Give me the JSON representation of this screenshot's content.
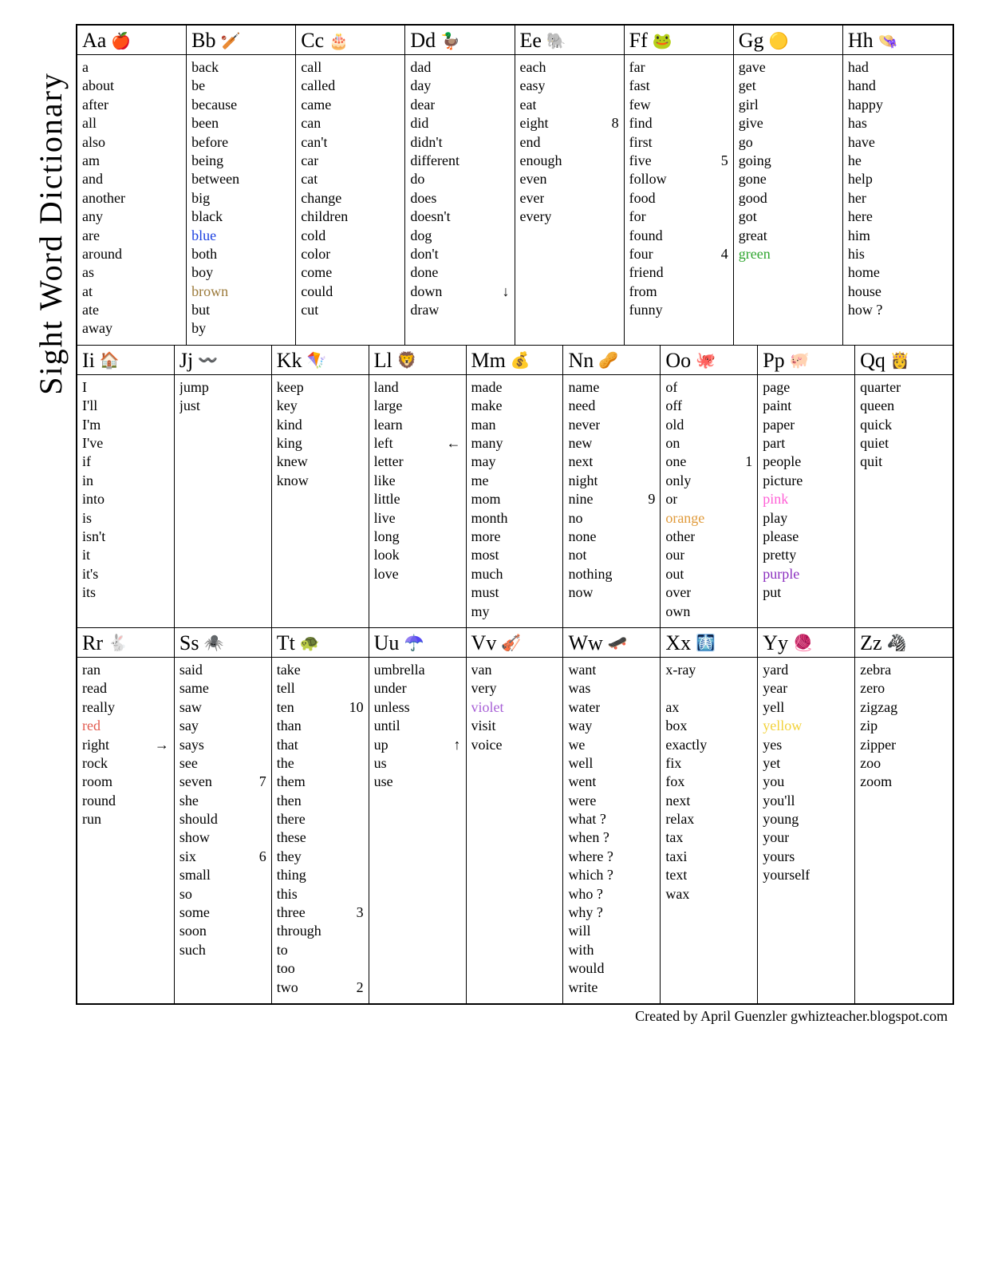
{
  "title": "Sight Word Dictionary",
  "footer": "Created by April Guenzler   gwhizteacher.blogspot.com",
  "rows": [
    {
      "cells": [
        {
          "letter": "Aa",
          "icon": "🍎",
          "words": [
            {
              "t": "a"
            },
            {
              "t": "about"
            },
            {
              "t": "after"
            },
            {
              "t": "all"
            },
            {
              "t": "also"
            },
            {
              "t": "am"
            },
            {
              "t": "and"
            },
            {
              "t": "another"
            },
            {
              "t": "any"
            },
            {
              "t": "are"
            },
            {
              "t": "around"
            },
            {
              "t": "as"
            },
            {
              "t": "at"
            },
            {
              "t": "ate"
            },
            {
              "t": "away"
            }
          ]
        },
        {
          "letter": "Bb",
          "icon": "🏏",
          "words": [
            {
              "t": "back"
            },
            {
              "t": "be"
            },
            {
              "t": "because"
            },
            {
              "t": "been"
            },
            {
              "t": "before"
            },
            {
              "t": "being"
            },
            {
              "t": "between"
            },
            {
              "t": "big"
            },
            {
              "t": "black"
            },
            {
              "t": "blue",
              "c": "#1a3fe0"
            },
            {
              "t": "both"
            },
            {
              "t": "boy"
            },
            {
              "t": "brown",
              "c": "#9b7a3a"
            },
            {
              "t": "but"
            },
            {
              "t": "by"
            }
          ]
        },
        {
          "letter": "Cc",
          "icon": "🎂",
          "words": [
            {
              "t": "call"
            },
            {
              "t": "called"
            },
            {
              "t": "came"
            },
            {
              "t": "can"
            },
            {
              "t": "can't"
            },
            {
              "t": "car"
            },
            {
              "t": "cat"
            },
            {
              "t": "change"
            },
            {
              "t": "children"
            },
            {
              "t": "cold"
            },
            {
              "t": "color"
            },
            {
              "t": "come"
            },
            {
              "t": "could"
            },
            {
              "t": "cut"
            }
          ]
        },
        {
          "letter": "Dd",
          "icon": "🦆",
          "words": [
            {
              "t": "dad"
            },
            {
              "t": "day"
            },
            {
              "t": "dear"
            },
            {
              "t": "did"
            },
            {
              "t": "didn't"
            },
            {
              "t": "different"
            },
            {
              "t": "do"
            },
            {
              "t": "does"
            },
            {
              "t": "doesn't"
            },
            {
              "t": "dog"
            },
            {
              "t": "don't"
            },
            {
              "t": "done"
            },
            {
              "t": "down",
              "e": "↓"
            },
            {
              "t": "draw"
            }
          ]
        },
        {
          "letter": "Ee",
          "icon": "🐘",
          "words": [
            {
              "t": "each"
            },
            {
              "t": "easy"
            },
            {
              "t": "eat"
            },
            {
              "t": "eight",
              "e": "8"
            },
            {
              "t": "end"
            },
            {
              "t": "enough"
            },
            {
              "t": "even"
            },
            {
              "t": "ever"
            },
            {
              "t": "every"
            }
          ]
        },
        {
          "letter": "Ff",
          "icon": "🐸",
          "words": [
            {
              "t": "far"
            },
            {
              "t": "fast"
            },
            {
              "t": "few"
            },
            {
              "t": "find"
            },
            {
              "t": "first"
            },
            {
              "t": "five",
              "e": "5"
            },
            {
              "t": "follow"
            },
            {
              "t": "food"
            },
            {
              "t": "for"
            },
            {
              "t": "found"
            },
            {
              "t": "four",
              "e": "4"
            },
            {
              "t": "friend"
            },
            {
              "t": "from"
            },
            {
              "t": "funny"
            }
          ]
        },
        {
          "letter": "Gg",
          "icon": "🟡",
          "words": [
            {
              "t": "gave"
            },
            {
              "t": "get"
            },
            {
              "t": "girl"
            },
            {
              "t": "give"
            },
            {
              "t": "go"
            },
            {
              "t": "going"
            },
            {
              "t": "gone"
            },
            {
              "t": "good"
            },
            {
              "t": "got"
            },
            {
              "t": "great"
            },
            {
              "t": "green",
              "c": "#2fa52f"
            }
          ]
        },
        {
          "letter": "Hh",
          "icon": "👒",
          "words": [
            {
              "t": "had"
            },
            {
              "t": "hand"
            },
            {
              "t": "happy"
            },
            {
              "t": "has"
            },
            {
              "t": "have"
            },
            {
              "t": "he"
            },
            {
              "t": "help"
            },
            {
              "t": "her"
            },
            {
              "t": "here"
            },
            {
              "t": "him"
            },
            {
              "t": "his"
            },
            {
              "t": "home"
            },
            {
              "t": "house"
            },
            {
              "t": "how ?"
            }
          ]
        }
      ]
    },
    {
      "cells": [
        {
          "letter": "Ii",
          "icon": "🏠",
          "words": [
            {
              "t": "I"
            },
            {
              "t": "I'll"
            },
            {
              "t": "I'm"
            },
            {
              "t": "I've"
            },
            {
              "t": "if"
            },
            {
              "t": "in"
            },
            {
              "t": "into"
            },
            {
              "t": "is"
            },
            {
              "t": "isn't"
            },
            {
              "t": "it"
            },
            {
              "t": "it's"
            },
            {
              "t": "its"
            }
          ]
        },
        {
          "letter": "Jj",
          "icon": "〰️",
          "words": [
            {
              "t": "jump"
            },
            {
              "t": "just"
            }
          ]
        },
        {
          "letter": "Kk",
          "icon": "🪁",
          "words": [
            {
              "t": "keep"
            },
            {
              "t": "key"
            },
            {
              "t": "kind"
            },
            {
              "t": "king"
            },
            {
              "t": "knew"
            },
            {
              "t": "know"
            }
          ]
        },
        {
          "letter": "Ll",
          "icon": "🦁",
          "words": [
            {
              "t": "land"
            },
            {
              "t": "large"
            },
            {
              "t": "learn"
            },
            {
              "t": "left",
              "e": "←"
            },
            {
              "t": "letter"
            },
            {
              "t": "like"
            },
            {
              "t": "little"
            },
            {
              "t": "live"
            },
            {
              "t": "long"
            },
            {
              "t": "look"
            },
            {
              "t": "love"
            }
          ]
        },
        {
          "letter": "Mm",
          "icon": "💰",
          "words": [
            {
              "t": "made"
            },
            {
              "t": "make"
            },
            {
              "t": "man"
            },
            {
              "t": "many"
            },
            {
              "t": "may"
            },
            {
              "t": "me"
            },
            {
              "t": "mom"
            },
            {
              "t": "month"
            },
            {
              "t": "more"
            },
            {
              "t": "most"
            },
            {
              "t": "much"
            },
            {
              "t": "must"
            },
            {
              "t": "my"
            }
          ]
        },
        {
          "letter": "Nn",
          "icon": "🥜",
          "words": [
            {
              "t": "name"
            },
            {
              "t": "need"
            },
            {
              "t": "never"
            },
            {
              "t": "new"
            },
            {
              "t": "next"
            },
            {
              "t": "night"
            },
            {
              "t": "nine",
              "e": "9"
            },
            {
              "t": "no"
            },
            {
              "t": "none"
            },
            {
              "t": "not"
            },
            {
              "t": "nothing"
            },
            {
              "t": "now"
            }
          ]
        },
        {
          "letter": "Oo",
          "icon": "🐙",
          "words": [
            {
              "t": "of"
            },
            {
              "t": "off"
            },
            {
              "t": "old"
            },
            {
              "t": "on"
            },
            {
              "t": "one",
              "e": "1"
            },
            {
              "t": "only"
            },
            {
              "t": "or"
            },
            {
              "t": "orange",
              "c": "#e09a3a"
            },
            {
              "t": "other"
            },
            {
              "t": "our"
            },
            {
              "t": "out"
            },
            {
              "t": "over"
            },
            {
              "t": "own"
            }
          ]
        },
        {
          "letter": "Pp",
          "icon": "🐖",
          "words": [
            {
              "t": "page"
            },
            {
              "t": "paint"
            },
            {
              "t": "paper"
            },
            {
              "t": "part"
            },
            {
              "t": "people"
            },
            {
              "t": "picture"
            },
            {
              "t": "pink",
              "c": "#ff5fd6"
            },
            {
              "t": "play"
            },
            {
              "t": "please"
            },
            {
              "t": "pretty"
            },
            {
              "t": "purple",
              "c": "#8b2fbf"
            },
            {
              "t": "put"
            }
          ]
        },
        {
          "letter": "Qq",
          "icon": "👸",
          "words": [
            {
              "t": "quarter"
            },
            {
              "t": "queen"
            },
            {
              "t": "quick"
            },
            {
              "t": "quiet"
            },
            {
              "t": "quit"
            }
          ]
        }
      ]
    },
    {
      "cells": [
        {
          "letter": "Rr",
          "icon": "🐇",
          "words": [
            {
              "t": "ran"
            },
            {
              "t": "read"
            },
            {
              "t": "really"
            },
            {
              "t": "red",
              "c": "#e25b4f"
            },
            {
              "t": "right",
              "e": "→"
            },
            {
              "t": "rock"
            },
            {
              "t": "room"
            },
            {
              "t": "round"
            },
            {
              "t": "run"
            }
          ]
        },
        {
          "letter": "Ss",
          "icon": "🕷️",
          "words": [
            {
              "t": "said"
            },
            {
              "t": "same"
            },
            {
              "t": "saw"
            },
            {
              "t": "say"
            },
            {
              "t": "says"
            },
            {
              "t": "see"
            },
            {
              "t": "seven",
              "e": "7"
            },
            {
              "t": "she"
            },
            {
              "t": "should"
            },
            {
              "t": "show"
            },
            {
              "t": "six",
              "e": "6"
            },
            {
              "t": "small"
            },
            {
              "t": "so"
            },
            {
              "t": "some"
            },
            {
              "t": "soon"
            },
            {
              "t": "such"
            }
          ]
        },
        {
          "letter": "Tt",
          "icon": "🐢",
          "words": [
            {
              "t": "take"
            },
            {
              "t": "tell"
            },
            {
              "t": "ten",
              "e": "10"
            },
            {
              "t": "than"
            },
            {
              "t": "that"
            },
            {
              "t": "the"
            },
            {
              "t": "them"
            },
            {
              "t": "then"
            },
            {
              "t": "there"
            },
            {
              "t": "these"
            },
            {
              "t": "they"
            },
            {
              "t": "thing"
            },
            {
              "t": "this"
            },
            {
              "t": "three",
              "e": "3"
            },
            {
              "t": "through"
            },
            {
              "t": "to"
            },
            {
              "t": "too"
            },
            {
              "t": "two",
              "e": "2"
            }
          ]
        },
        {
          "letter": "Uu",
          "icon": "☂️",
          "words": [
            {
              "t": "umbrella"
            },
            {
              "t": "under"
            },
            {
              "t": "unless"
            },
            {
              "t": "until"
            },
            {
              "t": "up",
              "e": "↑"
            },
            {
              "t": "us"
            },
            {
              "t": "use"
            }
          ]
        },
        {
          "letter": "Vv",
          "icon": "🎻",
          "words": [
            {
              "t": "van"
            },
            {
              "t": "very"
            },
            {
              "t": "violet",
              "c": "#a75fd6"
            },
            {
              "t": "visit"
            },
            {
              "t": "voice"
            }
          ]
        },
        {
          "letter": "Ww",
          "icon": "🛹",
          "words": [
            {
              "t": "want"
            },
            {
              "t": "was"
            },
            {
              "t": "water"
            },
            {
              "t": "way"
            },
            {
              "t": "we"
            },
            {
              "t": "well"
            },
            {
              "t": "went"
            },
            {
              "t": "were"
            },
            {
              "t": "what ?"
            },
            {
              "t": "when ?"
            },
            {
              "t": "where ?"
            },
            {
              "t": "which ?"
            },
            {
              "t": "who ?"
            },
            {
              "t": "why ?"
            },
            {
              "t": "will"
            },
            {
              "t": "with"
            },
            {
              "t": "would"
            },
            {
              "t": "write"
            }
          ]
        },
        {
          "letter": "Xx",
          "icon": "🩻",
          "words": [
            {
              "t": "x-ray"
            },
            {
              "t": ""
            },
            {
              "t": "ax"
            },
            {
              "t": "box"
            },
            {
              "t": "exactly"
            },
            {
              "t": "fix"
            },
            {
              "t": "fox"
            },
            {
              "t": "next"
            },
            {
              "t": "relax"
            },
            {
              "t": "tax"
            },
            {
              "t": "taxi"
            },
            {
              "t": "text"
            },
            {
              "t": "wax"
            }
          ]
        },
        {
          "letter": "Yy",
          "icon": "🧶",
          "words": [
            {
              "t": "yard"
            },
            {
              "t": "year"
            },
            {
              "t": "yell"
            },
            {
              "t": "yellow",
              "c": "#f2d23a"
            },
            {
              "t": "yes"
            },
            {
              "t": "yet"
            },
            {
              "t": "you"
            },
            {
              "t": "you'll"
            },
            {
              "t": "young"
            },
            {
              "t": "your"
            },
            {
              "t": "yours"
            },
            {
              "t": "yourself"
            }
          ]
        },
        {
          "letter": "Zz",
          "icon": "🦓",
          "words": [
            {
              "t": "zebra"
            },
            {
              "t": "zero"
            },
            {
              "t": "zigzag"
            },
            {
              "t": "zip"
            },
            {
              "t": "zipper"
            },
            {
              "t": "zoo"
            },
            {
              "t": "zoom"
            }
          ]
        }
      ]
    }
  ]
}
